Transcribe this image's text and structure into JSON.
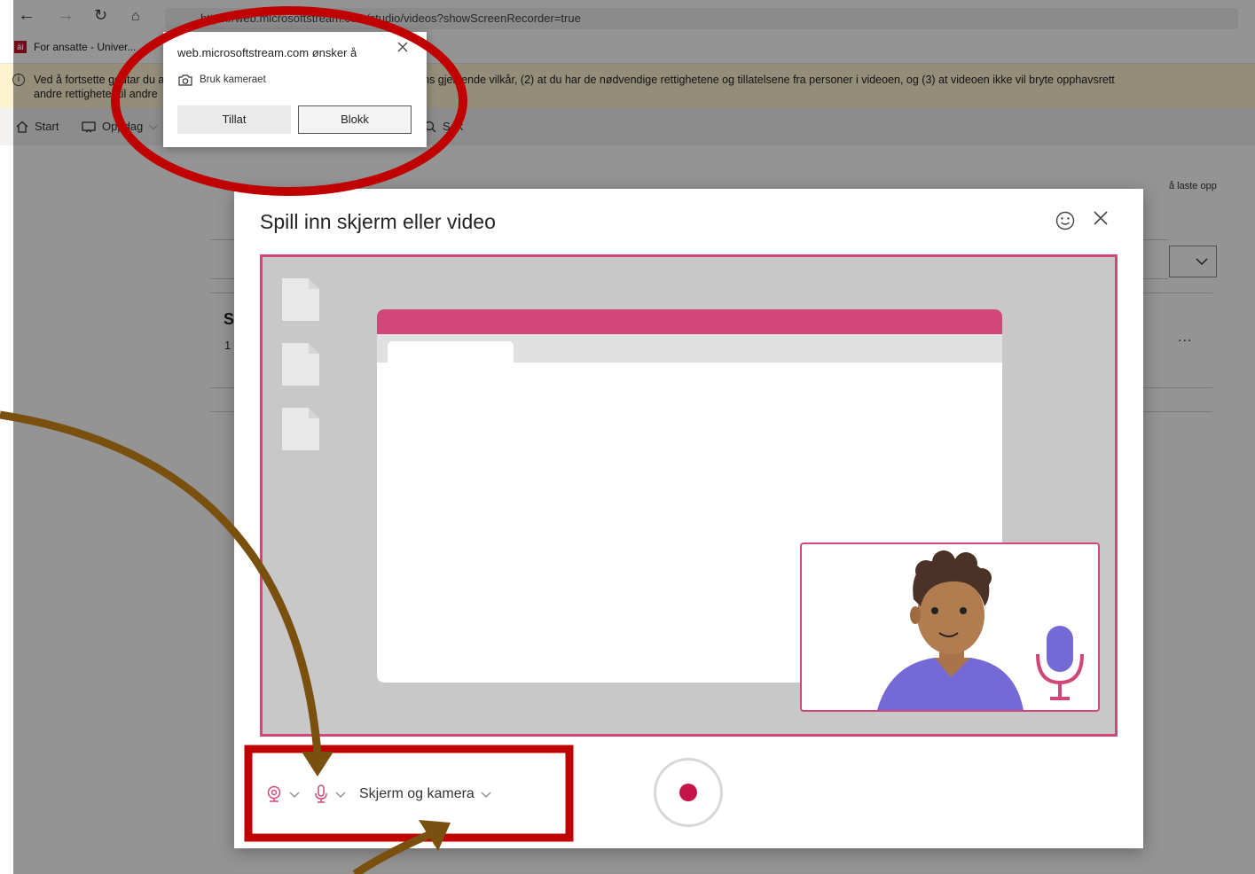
{
  "browser": {
    "address": "https://web.microsoftstream.com/studio/videos?showScreenRecorder=true",
    "favorite": {
      "icon_text": "äi",
      "label": "For ansatte - Univer..."
    }
  },
  "notice": {
    "line1": "Ved å fortsette godtar du at (1) du bruker videoen i samsvar med organisasjonens gjeldende vilkår, (2) at du har de nødvendige rettighetene og tillatelsene fra personer i videoen, og (3) at videoen ikke vil bryte opphavsrett",
    "line2": "andre rettigheter til andre"
  },
  "appnav": {
    "items": [
      {
        "label": "Start",
        "icon": "home-icon"
      },
      {
        "label": "Oppdag",
        "icon": "discover-icon"
      },
      {
        "label": "Søk",
        "icon": "search-icon"
      }
    ]
  },
  "page": {
    "right_text": "å laste opp",
    "dots": "...",
    "partial_heading": "S",
    "partial_number": "1"
  },
  "permission": {
    "title": "web.microsoftstream.com ønsker å",
    "camera_label": "Bruk kameraet",
    "allow_label": "Tillat",
    "block_label": "Blokk"
  },
  "modal": {
    "title": "Spill inn skjerm eller video",
    "mode_label": "Skjerm og kamera"
  },
  "colors": {
    "accent_pink": "#d1477a",
    "record_red": "#c4144a",
    "annotation_red": "#c00000",
    "arrow_brown": "#7a500e"
  }
}
